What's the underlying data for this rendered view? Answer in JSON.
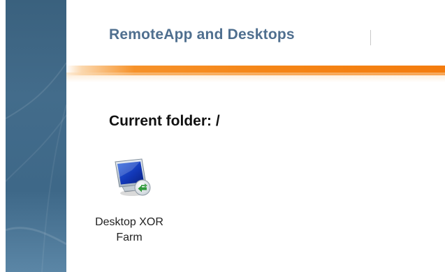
{
  "header": {
    "title": "RemoteApp and Desktops"
  },
  "content": {
    "folder_heading": "Current folder: /",
    "apps": [
      {
        "label_line1": "Desktop XOR",
        "label_line2": "Farm",
        "icon": "remote-desktop-monitor-icon"
      }
    ]
  },
  "colors": {
    "side_panel": "#436c8b",
    "title": "#4f6f8f",
    "accent_orange": "#f5851a",
    "heading_text": "#111111"
  }
}
